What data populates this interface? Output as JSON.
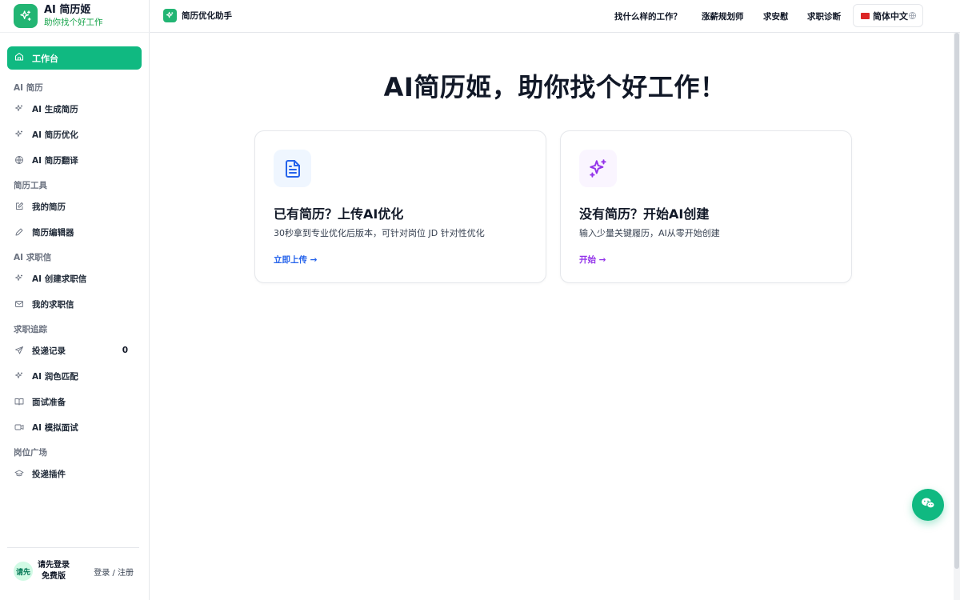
{
  "brand": {
    "title": "AI 简历姬",
    "subtitle": "助你找个好工作",
    "accent": "#22b573"
  },
  "header": {
    "title": "简历优化助手",
    "nav": [
      "找什么样的工作？",
      "涨薪规划师",
      "求安慰",
      "求职诊断"
    ],
    "language": "简体中文"
  },
  "sidebar": {
    "active": {
      "label": "工作台",
      "icon": "home-icon"
    },
    "groups": [
      {
        "title": "AI 简历",
        "items": [
          {
            "label": "AI 生成简历",
            "icon": "sparkle-icon"
          },
          {
            "label": "AI 简历优化",
            "icon": "sparkle-icon"
          },
          {
            "label": "AI 简历翻译",
            "icon": "globe-icon"
          }
        ]
      },
      {
        "title": "简历工具",
        "items": [
          {
            "label": "我的简历",
            "icon": "edit-icon"
          },
          {
            "label": "简历编辑器",
            "icon": "pencil-icon"
          }
        ]
      },
      {
        "title": "AI 求职信",
        "items": [
          {
            "label": "AI 创建求职信",
            "icon": "sparkle-icon"
          },
          {
            "label": "我的求职信",
            "icon": "mail-icon"
          }
        ]
      },
      {
        "title": "求职追踪",
        "items": [
          {
            "label": "投递记录",
            "icon": "send-icon",
            "count": "0"
          },
          {
            "label": "AI 润色匹配",
            "icon": "sparkle-icon"
          },
          {
            "label": "面试准备",
            "icon": "book-icon"
          },
          {
            "label": "AI 模拟面试",
            "icon": "video-icon"
          }
        ]
      },
      {
        "title": "岗位广场",
        "items": [
          {
            "label": "投递插件",
            "icon": "graduation-cap-icon"
          }
        ]
      }
    ],
    "user": {
      "avatar": "请先",
      "name": "请先登录",
      "plan": "免费版",
      "login": "登录 / 注册"
    }
  },
  "main": {
    "title": "AI简历姬，助你找个好工作！",
    "cards": [
      {
        "title": "已有简历？上传AI优化",
        "desc": "30秒拿到专业优化后版本，可针对岗位 JD 针对性优化",
        "link": "立即上传 →",
        "icon": "document-icon",
        "color": "#2563eb",
        "bg": "#eff6ff"
      },
      {
        "title": "没有简历？开始AI创建",
        "desc": "输入少量关键履历，AI从零开始创建",
        "link": "开始 →",
        "icon": "sparkles-icon",
        "color": "#9333ea",
        "bg": "#faf5ff"
      }
    ]
  }
}
